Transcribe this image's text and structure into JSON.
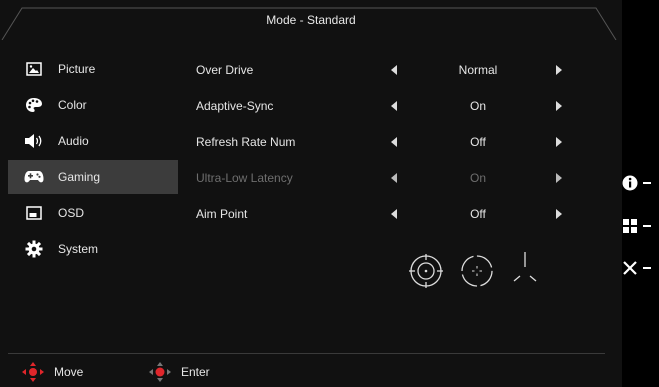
{
  "header": {
    "title": "Mode - Standard"
  },
  "sidebar": {
    "items": [
      {
        "label": "Picture",
        "icon": "picture-icon",
        "active": false
      },
      {
        "label": "Color",
        "icon": "palette-icon",
        "active": false
      },
      {
        "label": "Audio",
        "icon": "speaker-icon",
        "active": false
      },
      {
        "label": "Gaming",
        "icon": "gamepad-icon",
        "active": true
      },
      {
        "label": "OSD",
        "icon": "osd-icon",
        "active": false
      },
      {
        "label": "System",
        "icon": "gear-icon",
        "active": false
      }
    ]
  },
  "settings": [
    {
      "label": "Over Drive",
      "value": "Normal",
      "enabled": true
    },
    {
      "label": "Adaptive-Sync",
      "value": "On",
      "enabled": true
    },
    {
      "label": "Refresh Rate Num",
      "value": "Off",
      "enabled": true
    },
    {
      "label": "Ultra-Low Latency",
      "value": "On",
      "enabled": false
    },
    {
      "label": "Aim Point",
      "value": "Off",
      "enabled": true
    }
  ],
  "aim_point_options": [
    "aim-point-circle-icon",
    "aim-point-circle-dashed-icon",
    "aim-point-tri-icon"
  ],
  "footer": {
    "move_label": "Move",
    "enter_label": "Enter"
  },
  "right_bar": {
    "items": [
      "info-icon",
      "menu-grid-icon",
      "close-icon"
    ]
  },
  "colors": {
    "background": "#111111",
    "active_item": "#3c3c3c",
    "header_border": "#555555",
    "joystick_red": "#e0262b"
  }
}
